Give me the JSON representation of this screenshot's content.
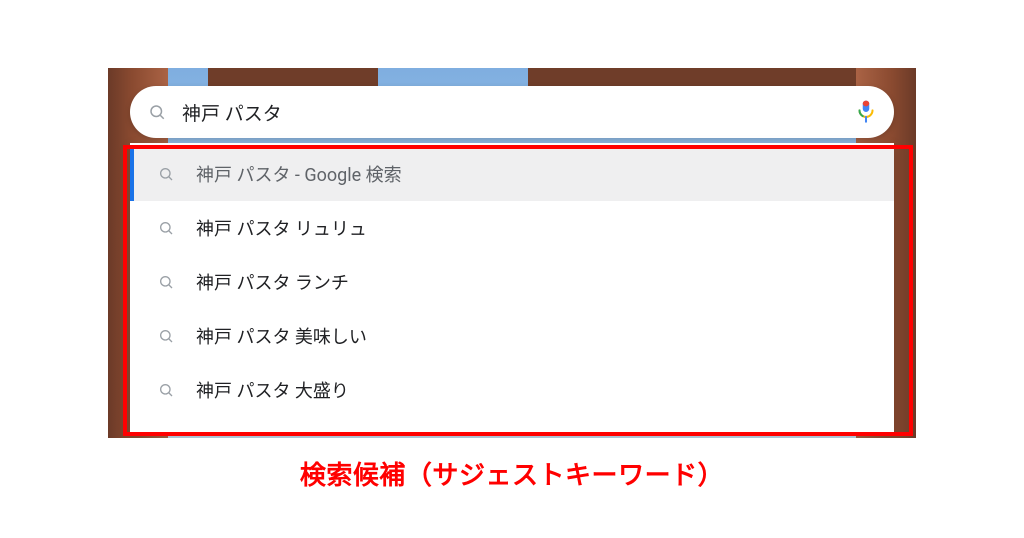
{
  "search": {
    "query": "神戸 パスタ"
  },
  "suggestions": [
    {
      "label": "神戸 パスタ - Google 検索",
      "selected": true
    },
    {
      "label": "神戸 パスタ リュリュ",
      "selected": false
    },
    {
      "label": "神戸 パスタ ランチ",
      "selected": false
    },
    {
      "label": "神戸 パスタ 美味しい",
      "selected": false
    },
    {
      "label": "神戸 パスタ 大盛り",
      "selected": false
    }
  ],
  "caption": "検索候補（サジェストキーワード）"
}
